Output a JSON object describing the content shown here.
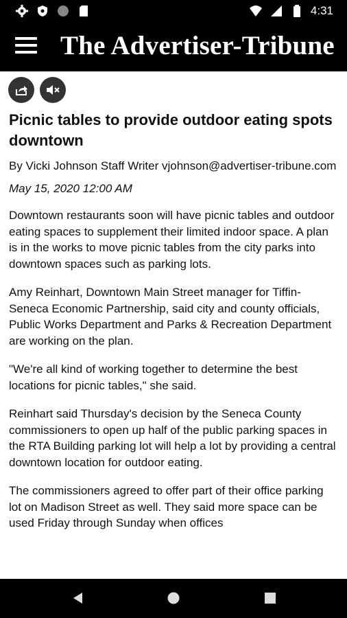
{
  "status": {
    "time": "4:31"
  },
  "header": {
    "masthead": "The Advertiser-Tribune"
  },
  "article": {
    "headline": "Picnic tables to provide outdoor eating spots downtown",
    "byline": "By Vicki Johnson Staff Writer vjohnson@advertiser-tribune.com",
    "date": "May 15, 2020 12:00 AM",
    "paragraphs": [
      "Downtown restaurants soon will have picnic tables and outdoor eating spaces to supplement their limited indoor space. A plan is in the works to move picnic tables from the city parks into downtown spaces such as parking lots.",
      "Amy Reinhart, Downtown Main Street manager for Tiffin-Seneca Economic Partnership, said city and county officials, Public Works Department and Parks & Recreation Department are working on the plan.",
      "\"We're all kind of working together to determine the best locations for picnic tables,\" she said.",
      "Reinhart said Thursday's decision by the Seneca County commissioners to open up half of the public parking spaces in the RTA Building parking lot will help a lot by providing a central downtown location for outdoor eating.",
      "The commissioners agreed to offer part of their office parking lot on Madison Street as well. They said more space can be used Friday through Sunday when offices"
    ]
  }
}
